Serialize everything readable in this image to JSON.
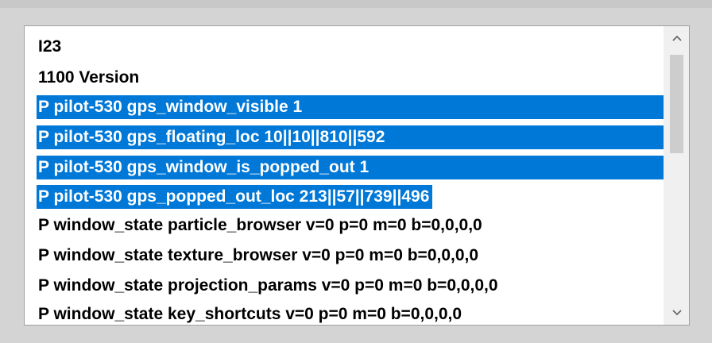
{
  "lines": [
    {
      "text": "I23",
      "selected": false
    },
    {
      "text": "1100 Version",
      "selected": false
    },
    {
      "text": "P pilot-530 gps_window_visible 1",
      "selected": true
    },
    {
      "text": "P pilot-530 gps_floating_loc 10||10||810||592",
      "selected": true
    },
    {
      "text": "P pilot-530 gps_window_is_popped_out 1",
      "selected": true
    },
    {
      "text": "P pilot-530 gps_popped_out_loc 213||57||739||496",
      "selected": true
    },
    {
      "text": "P window_state particle_browser v=0 p=0 m=0 b=0,0,0,0",
      "selected": false
    },
    {
      "text": "P window_state texture_browser v=0 p=0 m=0 b=0,0,0,0",
      "selected": false
    },
    {
      "text": "P window_state projection_params v=0 p=0 m=0 b=0,0,0,0",
      "selected": false
    },
    {
      "text": "P window_state key_shortcuts v=0 p=0 m=0 b=0,0,0,0",
      "selected": false
    }
  ],
  "scrollbar": {
    "up_icon": "chevron-up-icon",
    "down_icon": "chevron-down-icon"
  },
  "colors": {
    "selection": "#0078d7",
    "background": "#d4d4d4"
  }
}
